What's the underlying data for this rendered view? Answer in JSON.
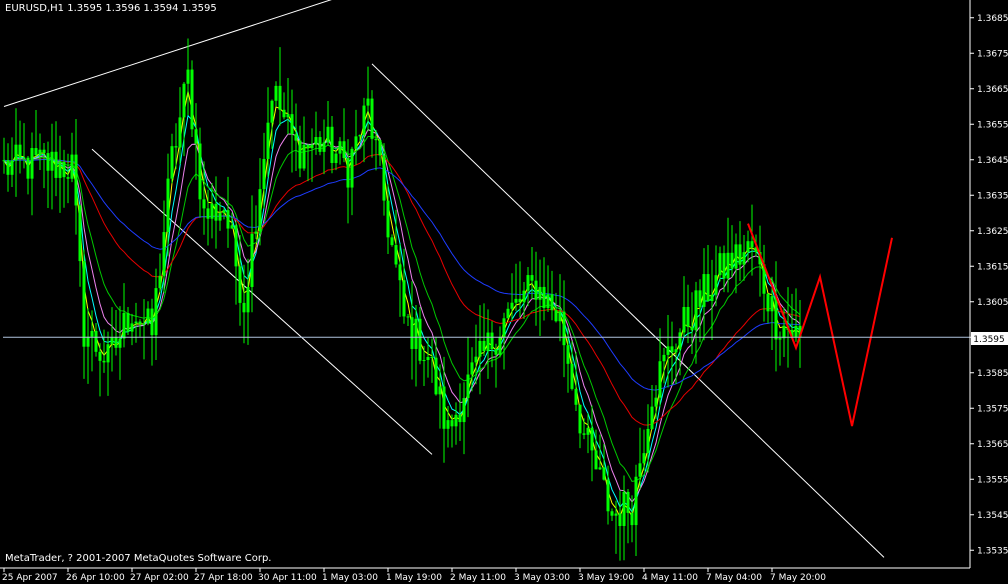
{
  "header": {
    "symbol": "EURUSD,H1",
    "ohlc": "1.3595 1.3596 1.3594 1.3595"
  },
  "footer": {
    "copyright": "MetaTrader, ? 2001-2007 MetaQuotes Software Corp."
  },
  "colors": {
    "background": "#000000",
    "candles": "#00FF00",
    "axis": "#FFFFFF",
    "trendlines": "#FFFFFF",
    "price_line": "#B0C4DE",
    "ma_yellow": "#FFFF00",
    "ma_cyan": "#00FFFF",
    "ma_violet": "#EE82EE",
    "ma_green": "#00C800",
    "ma_red": "#E60000",
    "ma_blue": "#1E3CFF",
    "forecast": "#FF0000"
  },
  "chart_data": {
    "type": "candlestick",
    "price_axis": {
      "min": 1.353,
      "max": 1.369,
      "ticks": [
        "1.3685",
        "1.3675",
        "1.3665",
        "1.3655",
        "1.3645",
        "1.3635",
        "1.3625",
        "1.3615",
        "1.3605",
        "1.3595",
        "1.3585",
        "1.3575",
        "1.3565",
        "1.3555",
        "1.3545",
        "1.3535"
      ],
      "current_price_label": "1.3595",
      "current_price": 1.3595
    },
    "time_axis": {
      "labels": [
        "25 Apr 2007",
        "26 Apr 10:00",
        "27 Apr 02:00",
        "27 Apr 18:00",
        "30 Apr 11:00",
        "1 May 03:00",
        "1 May 19:00",
        "2 May 11:00",
        "3 May 03:00",
        "3 May 19:00",
        "4 May 11:00",
        "7 May 04:00",
        "7 May 20:00"
      ]
    },
    "bar_count": 200,
    "price_path": [
      [
        0,
        1.3643
      ],
      [
        10,
        1.3644
      ],
      [
        17,
        1.3643
      ],
      [
        20,
        1.3597
      ],
      [
        26,
        1.3588
      ],
      [
        32,
        1.3603
      ],
      [
        37,
        1.3596
      ],
      [
        42,
        1.3645
      ],
      [
        46,
        1.3668
      ],
      [
        50,
        1.3629
      ],
      [
        55,
        1.3632
      ],
      [
        60,
        1.3605
      ],
      [
        67,
        1.3665
      ],
      [
        73,
        1.3648
      ],
      [
        80,
        1.365
      ],
      [
        86,
        1.3643
      ],
      [
        91,
        1.366
      ],
      [
        93,
        1.3647
      ],
      [
        100,
        1.36
      ],
      [
        106,
        1.359
      ],
      [
        111,
        1.3568
      ],
      [
        115,
        1.358
      ],
      [
        120,
        1.359
      ],
      [
        125,
        1.36
      ],
      [
        133,
        1.361
      ],
      [
        139,
        1.36
      ],
      [
        145,
        1.3567
      ],
      [
        152,
        1.3545
      ],
      [
        157,
        1.3548
      ],
      [
        162,
        1.358
      ],
      [
        168,
        1.3595
      ],
      [
        175,
        1.3607
      ],
      [
        181,
        1.3616
      ],
      [
        187,
        1.362
      ],
      [
        193,
        1.36
      ],
      [
        199,
        1.3595
      ]
    ],
    "moving_averages": [
      {
        "color_key": "ma_yellow",
        "period": 3
      },
      {
        "color_key": "ma_cyan",
        "period": 5
      },
      {
        "color_key": "ma_violet",
        "period": 8
      },
      {
        "color_key": "ma_green",
        "period": 13
      },
      {
        "color_key": "ma_red",
        "period": 34
      },
      {
        "color_key": "ma_blue",
        "period": 55
      }
    ],
    "trendlines": [
      {
        "from": [
          0,
          1.366
        ],
        "to": [
          87,
          1.3692
        ]
      },
      {
        "from": [
          22,
          1.3648
        ],
        "to": [
          107,
          1.3562
        ]
      },
      {
        "from": [
          92,
          1.3672
        ],
        "to": [
          220,
          1.3533
        ]
      }
    ],
    "forecast_zigzag": [
      [
        186,
        1.3627
      ],
      [
        198,
        1.3592
      ],
      [
        204,
        1.3612
      ],
      [
        212,
        1.357
      ],
      [
        222,
        1.3623
      ]
    ]
  }
}
